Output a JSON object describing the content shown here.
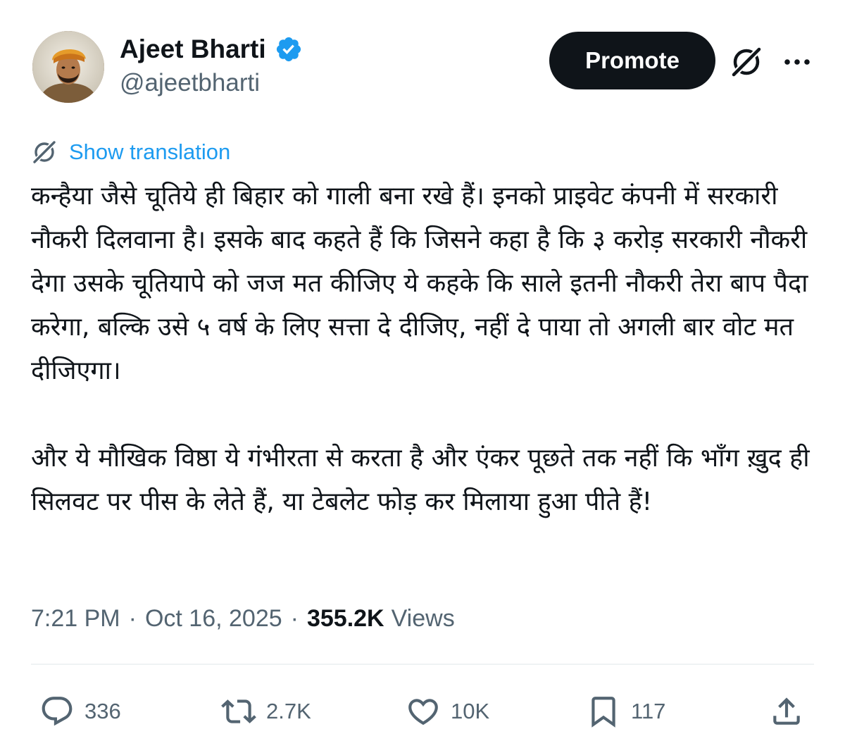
{
  "author": {
    "display_name": "Ajeet Bharti",
    "handle": "@ajeetbharti",
    "verified_icon": "verified-badge-icon",
    "avatar_icon": "avatar-photo"
  },
  "header": {
    "promote_label": "Promote",
    "grok_icon": "grok-icon",
    "more_icon": "more-options-icon"
  },
  "translation": {
    "label": "Show translation",
    "icon": "grok-icon"
  },
  "tweet": {
    "paragraphs": [
      "कन्हैया जैसे चूतिये ही बिहार को गाली बना रखे हैं। इनको प्राइवेट कंपनी में सरकारी नौकरी दिलवाना है। इसके बाद कहते हैं कि जिसने कहा है कि ३ करोड़ सरकारी नौकरी देगा उसके चूतियापे को जज मत कीजिए ये कहके कि साले इतनी नौकरी तेरा बाप पैदा करेगा, बल्कि उसे ५ वर्ष के लिए सत्ता दे दीजिए, नहीं दे पाया तो अगली बार वोट मत दीजिएगा।",
      "और ये मौखिक विष्ठा ये गंभीरता से करता है और एंकर पूछते तक नहीं कि भाँग ख़ुद ही सिलवट पर पीस के लेते हैं, या टेबलेट फोड़ कर मिलाया हुआ पीते हैं!"
    ]
  },
  "meta": {
    "time": "7:21 PM",
    "date": "Oct 16, 2025",
    "separator": "·",
    "views_count": "355.2K",
    "views_label": "Views"
  },
  "actions": {
    "replies": {
      "icon": "reply-icon",
      "count": "336"
    },
    "reposts": {
      "icon": "repost-icon",
      "count": "2.7K"
    },
    "likes": {
      "icon": "like-icon",
      "count": "10K"
    },
    "bookmarks": {
      "icon": "bookmark-icon",
      "count": "117"
    },
    "share": {
      "icon": "share-icon"
    }
  },
  "colors": {
    "text_primary": "#0f1419",
    "text_secondary": "#536471",
    "link_blue": "#1d9bf0",
    "verified_blue": "#1d9bf0",
    "button_dark": "#0f1419",
    "divider": "#eff3f4"
  }
}
